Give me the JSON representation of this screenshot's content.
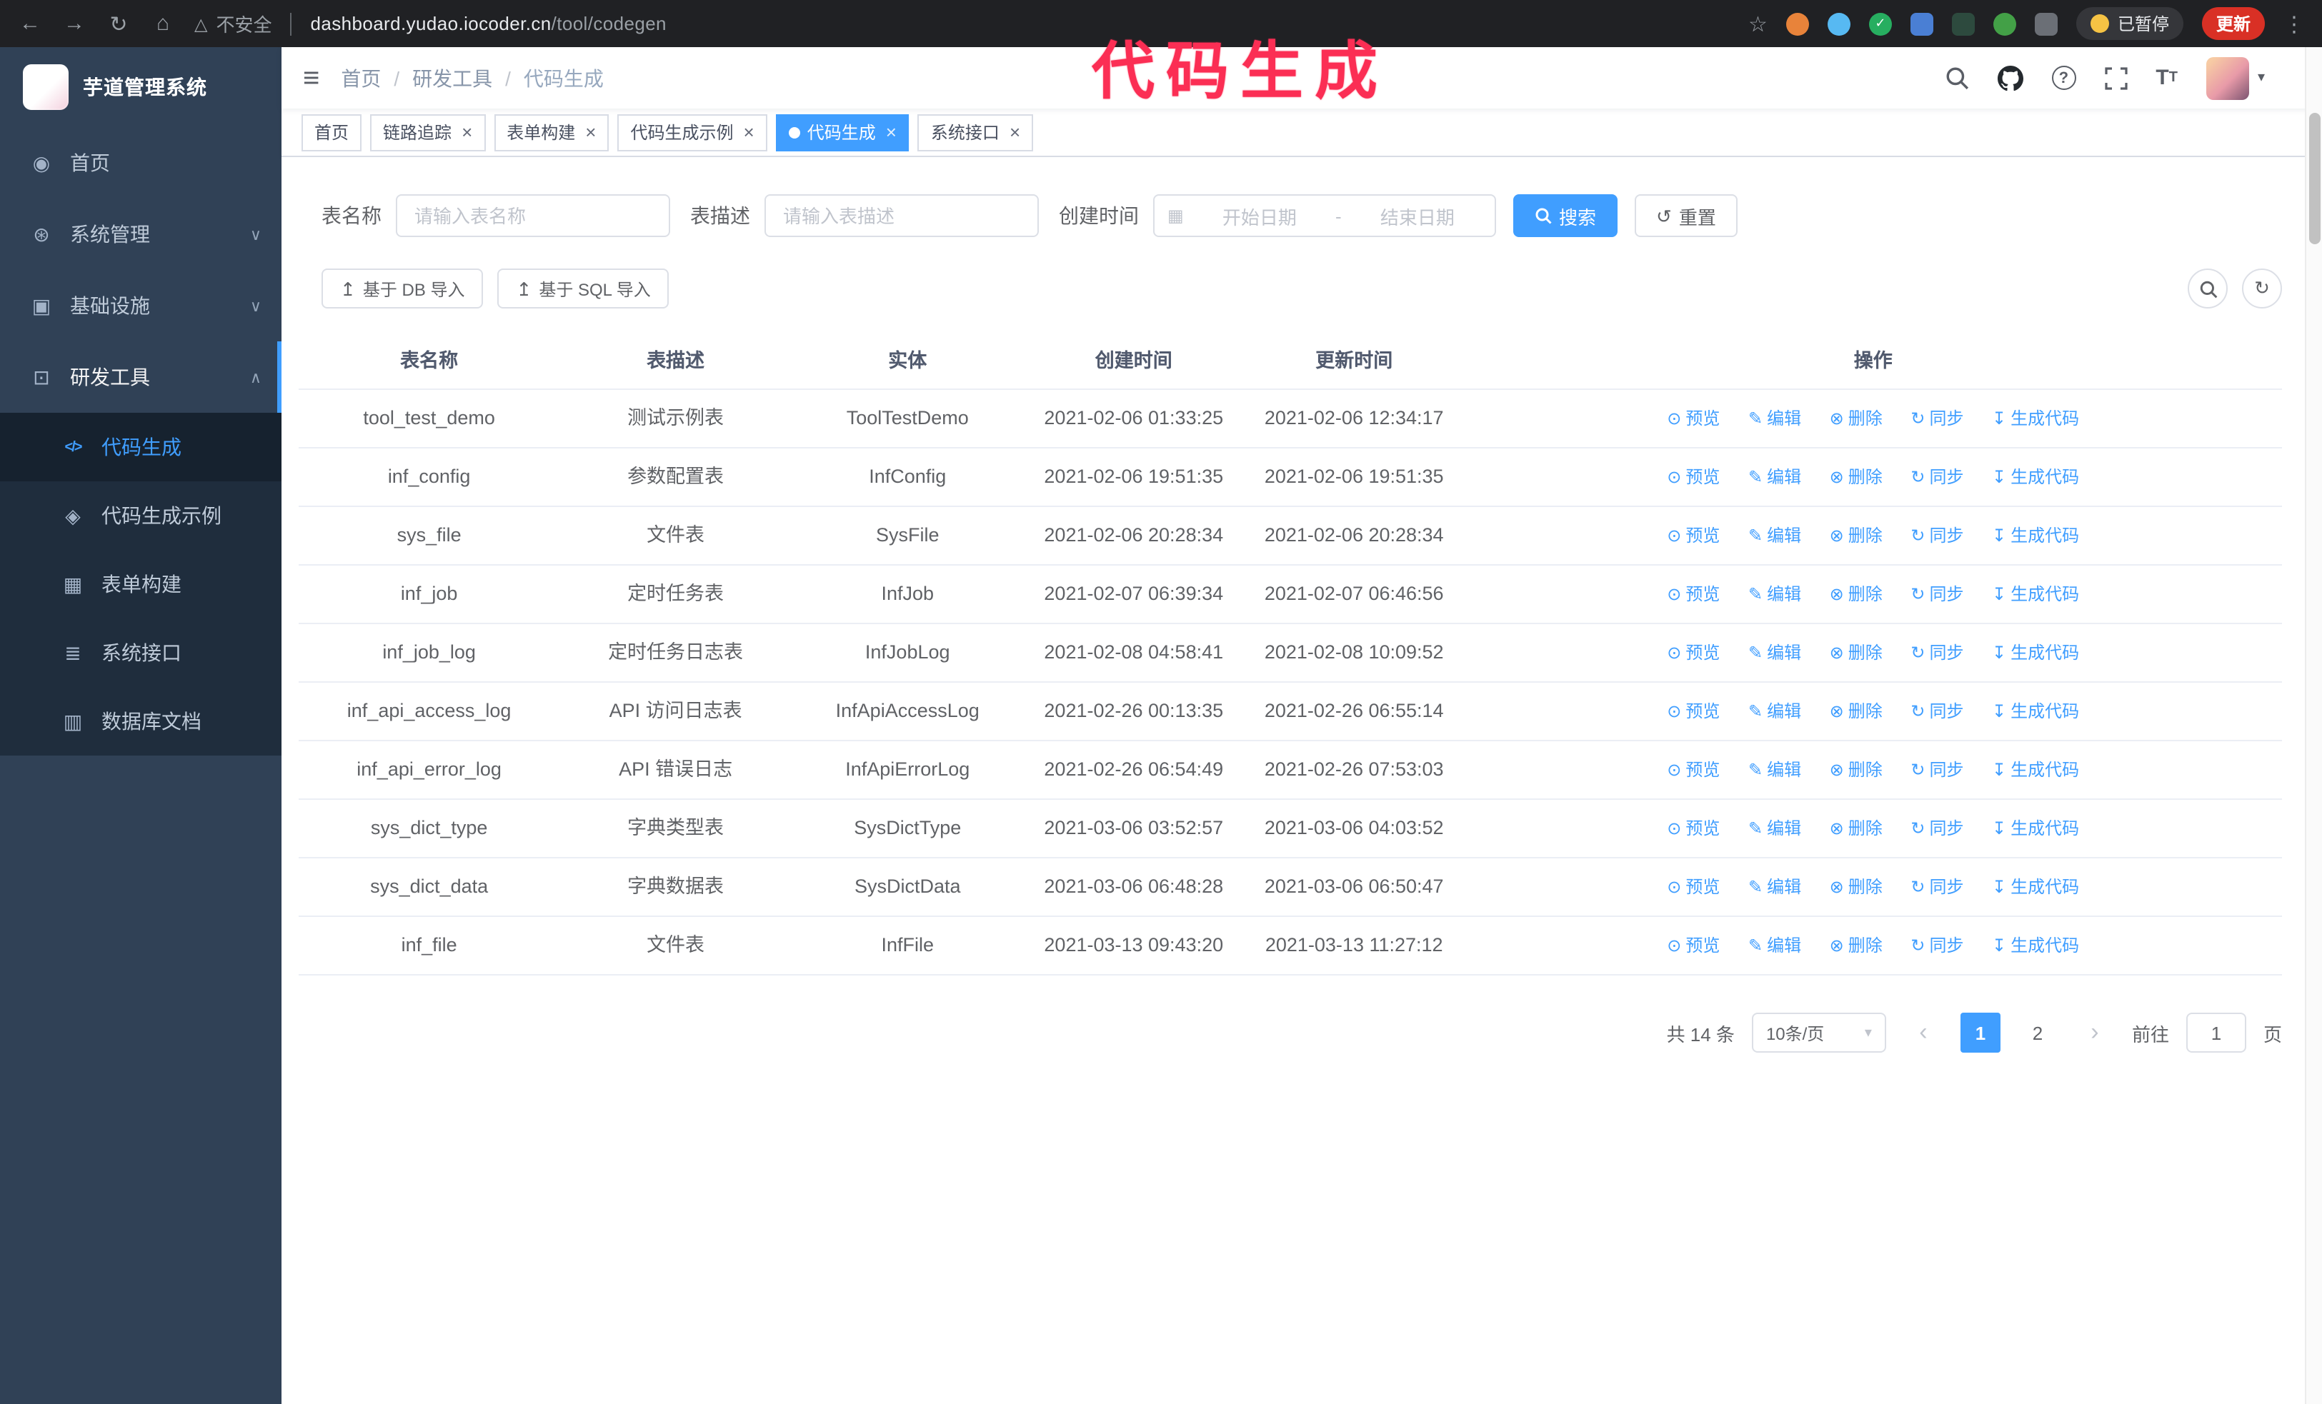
{
  "annotation": {
    "text": "代码生成",
    "color": "#fb2e54"
  },
  "colors": {
    "accent": "#409eff",
    "sidebar_bg": "#304156",
    "submenu_bg": "#1f2d3d",
    "chrome_bg": "#202124",
    "update_badge": "#d93025",
    "annotation": "#fb2e54"
  },
  "browser": {
    "warning": "不安全",
    "url_host": "dashboard.yudao.iocoder.cn",
    "url_path": "/tool/codegen",
    "paused_badge": "已暂停",
    "update_button": "更新"
  },
  "sidebar": {
    "logo_title": "芋道管理系统",
    "items": [
      "首页",
      "系统管理",
      "基础设施",
      "研发工具"
    ],
    "subitems": [
      "代码生成",
      "代码生成示例",
      "表单构建",
      "系统接口",
      "数据库文档"
    ]
  },
  "header": {
    "breadcrumb": [
      "首页",
      "研发工具",
      "代码生成"
    ]
  },
  "tabs": [
    "首页",
    "链路追踪",
    "表单构建",
    "代码生成示例",
    "代码生成",
    "系统接口"
  ],
  "filters": {
    "table_name_label": "表名称",
    "table_name_placeholder": "请输入表名称",
    "table_desc_label": "表描述",
    "table_desc_placeholder": "请输入表描述",
    "create_time_label": "创建时间",
    "start_date_placeholder": "开始日期",
    "range_separator": "-",
    "end_date_placeholder": "结束日期",
    "search_label": "搜索",
    "reset_label": "重置"
  },
  "toolbar": {
    "import_db": "基于 DB 导入",
    "import_sql": "基于 SQL 导入"
  },
  "table": {
    "columns": [
      "表名称",
      "表描述",
      "实体",
      "创建时间",
      "更新时间",
      "操作"
    ],
    "actions": [
      "预览",
      "编辑",
      "删除",
      "同步",
      "生成代码"
    ],
    "rows": [
      {
        "name": "tool_test_demo",
        "desc": "测试示例表",
        "entity": "ToolTestDemo",
        "created": "2021-02-06 01:33:25",
        "updated": "2021-02-06 12:34:17"
      },
      {
        "name": "inf_config",
        "desc": "参数配置表",
        "entity": "InfConfig",
        "created": "2021-02-06 19:51:35",
        "updated": "2021-02-06 19:51:35"
      },
      {
        "name": "sys_file",
        "desc": "文件表",
        "entity": "SysFile",
        "created": "2021-02-06 20:28:34",
        "updated": "2021-02-06 20:28:34"
      },
      {
        "name": "inf_job",
        "desc": "定时任务表",
        "entity": "InfJob",
        "created": "2021-02-07 06:39:34",
        "updated": "2021-02-07 06:46:56"
      },
      {
        "name": "inf_job_log",
        "desc": "定时任务日志表",
        "entity": "InfJobLog",
        "created": "2021-02-08 04:58:41",
        "updated": "2021-02-08 10:09:52"
      },
      {
        "name": "inf_api_access_log",
        "desc": "API 访问日志表",
        "entity": "InfApiAccessLog",
        "created": "2021-02-26 00:13:35",
        "updated": "2021-02-26 06:55:14"
      },
      {
        "name": "inf_api_error_log",
        "desc": "API 错误日志",
        "entity": "InfApiErrorLog",
        "created": "2021-02-26 06:54:49",
        "updated": "2021-02-26 07:53:03"
      },
      {
        "name": "sys_dict_type",
        "desc": "字典类型表",
        "entity": "SysDictType",
        "created": "2021-03-06 03:52:57",
        "updated": "2021-03-06 04:03:52"
      },
      {
        "name": "sys_dict_data",
        "desc": "字典数据表",
        "entity": "SysDictData",
        "created": "2021-03-06 06:48:28",
        "updated": "2021-03-06 06:50:47"
      },
      {
        "name": "inf_file",
        "desc": "文件表",
        "entity": "InfFile",
        "created": "2021-03-13 09:43:20",
        "updated": "2021-03-13 11:27:12"
      }
    ]
  },
  "pagination": {
    "total": "共 14 条",
    "page_size": "10条/页",
    "page1": "1",
    "page2": "2",
    "goto_label": "前往",
    "goto_value": "1",
    "unit_label": "页"
  }
}
